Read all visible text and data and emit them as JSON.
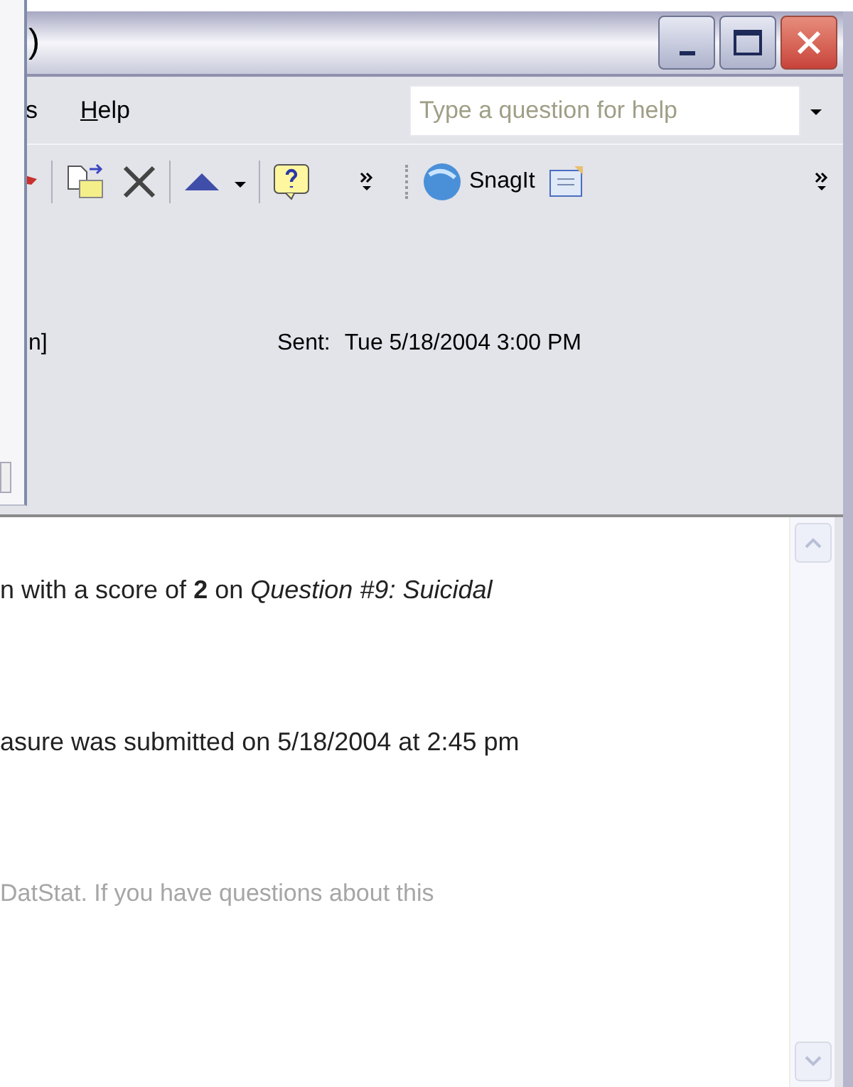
{
  "window": {
    "title": ")"
  },
  "menu": [
    {
      "label": "s",
      "mnemonic": false
    },
    {
      "label": "Help",
      "mnemonic": true
    }
  ],
  "help_box": {
    "placeholder": "Type a question for help"
  },
  "toolbar": {
    "snagit_label": "SnagIt"
  },
  "header": {
    "from_tail": "n]",
    "sent_label": "Sent:",
    "sent_value": "Tue 5/18/2004 3:00 PM"
  },
  "body": {
    "paragraphs": [
      {
        "text": "n with a score of **2** on *Question #9: Suicidal*",
        "muted": false
      },
      {
        "text": "asure was submitted on 5/18/2004 at 2:45 pm",
        "muted": false
      },
      {
        "text": "DatStat. If you have questions about this",
        "muted": true
      }
    ]
  }
}
